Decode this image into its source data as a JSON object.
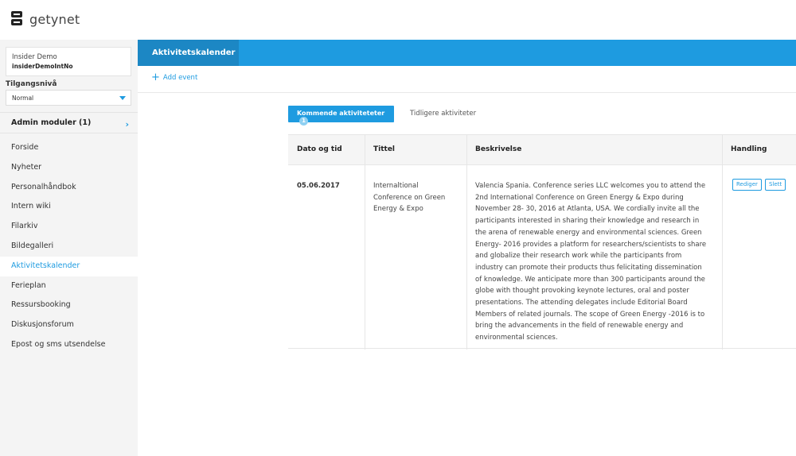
{
  "app": {
    "logo_text": "getynet"
  },
  "sidebar": {
    "user": {
      "name": "Insider Demo",
      "id": "insiderDemoIntNo"
    },
    "access_label": "Tilgangsnivå",
    "access_value": "Normal",
    "admin_modules_label": "Admin moduler (1)",
    "items": [
      {
        "label": "Forside"
      },
      {
        "label": "Nyheter"
      },
      {
        "label": "Personalhåndbok"
      },
      {
        "label": "Intern wiki"
      },
      {
        "label": "Filarkiv"
      },
      {
        "label": "Bildegalleri"
      },
      {
        "label": "Aktivitetskalender",
        "active": true
      },
      {
        "label": "Ferieplan"
      },
      {
        "label": "Ressursbooking"
      },
      {
        "label": "Diskusjonsforum"
      },
      {
        "label": "Epost og sms utsendelse"
      }
    ]
  },
  "header": {
    "title": "Aktivitetskalender"
  },
  "actions": {
    "add_event": "Add event"
  },
  "tabs": {
    "upcoming": {
      "label": "Kommende aktiviteteter",
      "count": "1"
    },
    "previous": {
      "label": "Tidligere aktiviteter"
    }
  },
  "table": {
    "columns": [
      "Dato og tid",
      "Tittel",
      "Beskrivelse",
      "Handling"
    ],
    "rows": [
      {
        "date": "05.06.2017",
        "title_lines": [
          "Internaltional",
          "Conference on Green",
          "Energy & Expo"
        ],
        "description_lines": [
          "Valencia Spania. Conference series LLC welcomes you to attend the",
          "2nd International Conference on Green Energy & Expo during",
          "November 28- 30, 2016 at Atlanta, USA. We cordially invite all the",
          "participants interested in sharing their knowledge and research in",
          "the arena of renewable energy and environmental sciences. Green",
          "Energy- 2016 provides a platform for researchers/scientists to share",
          "and globalize their research work while the participants from",
          "industry can promote their products thus felicitating dissemination",
          "of knowledge. We anticipate more than 300 participants around the",
          "globe with thought provoking keynote lectures, oral and poster",
          "presentations. The attending delegates include Editorial Board",
          "Members of related journals. The scope of Green Energy -2016 is to",
          "bring the advancements in the field of renewable energy and",
          "environmental sciences."
        ],
        "edit_label": "Rediger",
        "delete_label": "Slett"
      }
    ]
  },
  "colors": {
    "accent": "#1e9be0",
    "accent_dark": "#1c87c4",
    "sidebar_bg": "#f4f4f4"
  }
}
